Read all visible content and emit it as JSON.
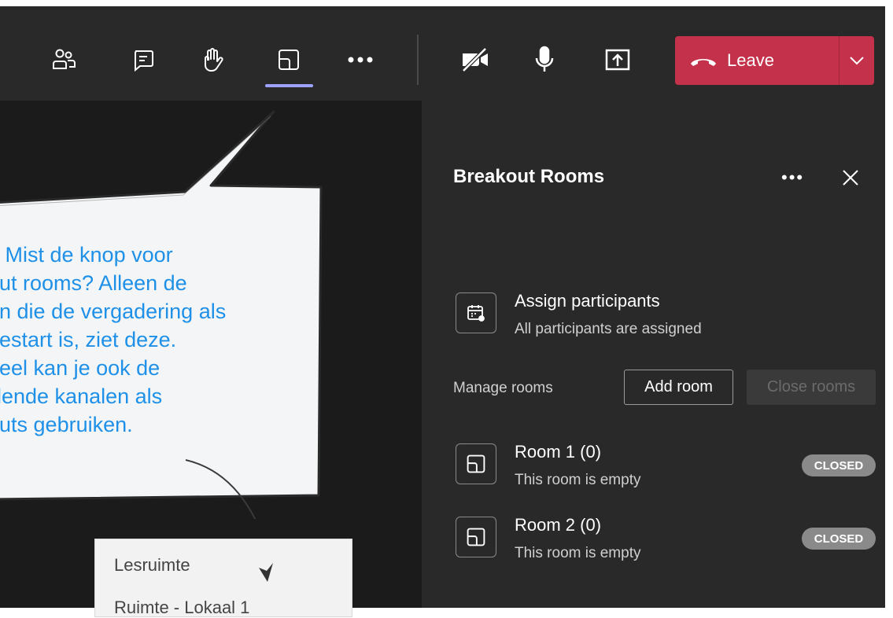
{
  "toolbar": {
    "leave_label": "Leave",
    "icons": [
      "people-icon",
      "chat-icon",
      "raise-hand-icon",
      "breakout-rooms-icon",
      "more-icon",
      "camera-off-icon",
      "microphone-icon",
      "share-screen-icon"
    ],
    "leave_color": "#c4314b",
    "active_indicator_color": "#9ea2ff"
  },
  "panel": {
    "title": "Breakout Rooms",
    "more_label": "•••",
    "assign": {
      "title": "Assign participants",
      "subtitle": "All participants are assigned"
    },
    "manage_label": "Manage rooms",
    "add_room_label": "Add room",
    "close_rooms_label": "Close rooms",
    "rooms": [
      {
        "name": "Room 1 (0)",
        "status": "This room is empty",
        "badge": "CLOSED"
      },
      {
        "name": "Room 2 (0)",
        "status": "This room is empty",
        "badge": "CLOSED"
      }
    ]
  },
  "callout": {
    "lines": [
      "e Mist de knop voor",
      "out rooms? Alleen de",
      "on die de vergadering als",
      "gestart is, ziet deze.",
      "heel kan je ook de",
      "illende kanalen als",
      "outs gebruiken."
    ],
    "text_color": "#1e90e8"
  },
  "channel_list": {
    "items": [
      "Lesruimte",
      "Ruimte - Lokaal 1"
    ]
  }
}
